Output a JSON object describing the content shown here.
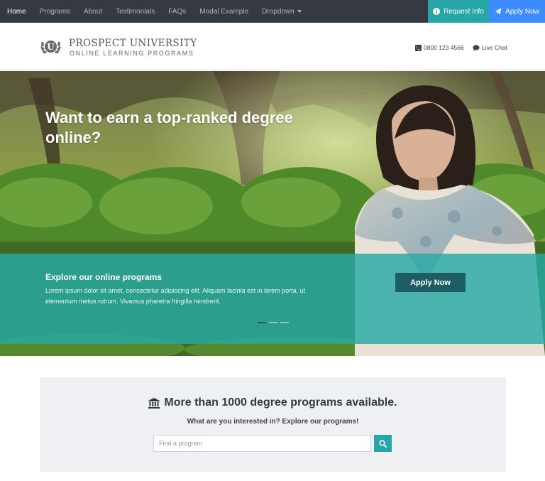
{
  "nav": {
    "links": [
      "Home",
      "Programs",
      "About",
      "Testimonials",
      "FAQs",
      "Modal Example",
      "Dropdown"
    ],
    "request_info": "Request Info",
    "apply_now": "Apply Now"
  },
  "header": {
    "emblem_letter": "U",
    "title": "PROSPECT UNIVERSITY",
    "subtitle": "ONLINE LEARNING PROGRAMS",
    "phone": "0800 123 4566",
    "live_chat": "Live Chat"
  },
  "hero": {
    "title": "Want to earn a top-ranked degree online?",
    "overlay_title": "Explore our online programs",
    "overlay_text": "Lorem ipsum dolor sit amet, consectetur adipiscing elit. Aliquam lacinia est in lorem porta, ut elementum metus rutrum. Vivamus pharetra fringilla hendrerit.",
    "apply_button": "Apply Now",
    "carousel_active_index": 0
  },
  "search": {
    "title": "More than 1000 degree programs available.",
    "subtitle": "What are you interested in? Explore our programs!",
    "placeholder": "Find a program",
    "value": ""
  },
  "colors": {
    "nav_bg": "#343a40",
    "teal": "#26a6a6",
    "blue": "#3d8bff",
    "dark_teal": "#1e5d62",
    "panel_bg": "#eef0f3"
  },
  "icons": [
    "info-icon",
    "paper-plane-icon",
    "laurel-icon",
    "phone-icon",
    "chat-icon",
    "university-icon",
    "search-icon"
  ]
}
